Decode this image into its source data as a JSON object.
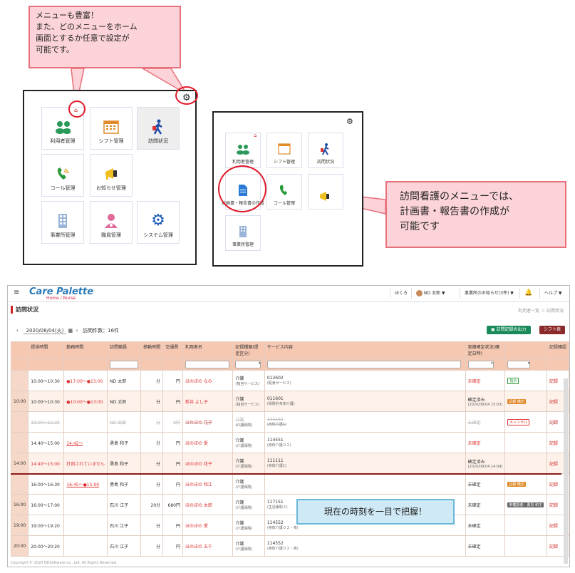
{
  "callouts": {
    "top_left": [
      "メニューも豊富！",
      "また、どのメニューをホーム",
      "画面とするか任意で設定が",
      "可能です。"
    ],
    "right": [
      "訪問看護のメニューでは、",
      "計画書・報告書の作成が",
      "可能です"
    ],
    "bottom": "現在の時刻を一目で把握！"
  },
  "panel1": {
    "tiles": [
      {
        "label": "利用者管理",
        "icon": "users-icon"
      },
      {
        "label": "シフト管理",
        "icon": "calendar-icon"
      },
      {
        "label": "訪問状況",
        "icon": "walking-person-icon"
      },
      {
        "label": "コール管理",
        "icon": "phone-icon"
      },
      {
        "label": "お知らせ管理",
        "icon": "megaphone-icon"
      },
      {
        "label": "事業所管理",
        "icon": "building-icon"
      },
      {
        "label": "職員管理",
        "icon": "staff-icon"
      },
      {
        "label": "システム管理",
        "icon": "gear-icon"
      }
    ]
  },
  "panel2": {
    "tiles": [
      {
        "label": "利用者管理",
        "icon": "users-icon"
      },
      {
        "label": "シフト管理",
        "icon": "calendar-icon"
      },
      {
        "label": "訪問状況",
        "icon": "walking-person-icon"
      },
      {
        "label": "計画書・報告書の作成",
        "icon": "document-icon"
      },
      {
        "label": "コール管理",
        "icon": "phone-icon"
      },
      {
        "label": "",
        "icon": "megaphone-icon"
      },
      {
        "label": "事業所管理",
        "icon": "building-icon"
      }
    ]
  },
  "app": {
    "logo": "Care Palette",
    "logo_sub": "Home / Nurse",
    "header": {
      "user1": "ほくろ",
      "user2": "ND 太郎",
      "notices": "事業所のお知らせ(3件)",
      "help": "ヘルプ"
    },
    "page_title": "訪問状況",
    "breadcrumb": "利用者一覧 ＞ 訪問状況",
    "date": "2020/08/04(火)",
    "visit_count": "訪問件数：16件",
    "btn_export": "訪問記録の出力",
    "btn_shift": "シフト表",
    "columns": [
      "",
      "提供時間",
      "勤務時間",
      "訪問職員",
      "移動時間",
      "交通費",
      "利用者名",
      "記録種類(提定区分)",
      "サービス内容",
      "",
      "実績確定状況(確定日時)",
      "",
      "記録確認"
    ],
    "rows": [
      {
        "hour": "",
        "time": "10:00～10:30",
        "work": "●17:00～●13:00",
        "staff": "ND 太郎",
        "move": "分",
        "fare": "円",
        "user": "ほのぼの なみ",
        "kind": "介護",
        "kind2": "(独自サービス)",
        "svc": "012602",
        "svc2": "(配食サービス)",
        "status": "未確定",
        "status2": "",
        "tag": "指示",
        "rec": "記録"
      },
      {
        "hour": "10:00",
        "time": "10:00～10:30",
        "work": "●10:00～●13:00",
        "staff": "ND 太郎",
        "move": "分",
        "fare": "円",
        "user": "新井 よし子",
        "kind": "介護",
        "kind2": "(独自サービス)",
        "svc": "011601",
        "svc2": "(保険外身体介護)",
        "status": "確定済み",
        "status2": "(2020/08/04 15:03)",
        "tag": "記録 備忘",
        "rec": "記録"
      },
      {
        "hour": "",
        "time": "10:00～10:30",
        "work": "",
        "staff": "ND 太郎",
        "move": "分",
        "fare": "0円",
        "user": "ほのぼの 花子",
        "kind": "介護",
        "kind2": "(介護保険)",
        "svc": "111111",
        "svc2": "(身体介護1)",
        "status": "未確定",
        "status2": "",
        "tag": "キャンセル",
        "rec": "記録"
      },
      {
        "hour": "",
        "time": "14:40～15:00",
        "work": "14:42～",
        "staff": "勇島 和子",
        "move": "分",
        "fare": "円",
        "user": "ほのぼの 愛",
        "kind": "介護",
        "kind2": "(介護保険)",
        "svc": "114551",
        "svc2": "(身体介護０２)",
        "status": "未確定",
        "status2": "",
        "tag": "",
        "rec": "記録"
      },
      {
        "hour": "14:00",
        "time": "14:40～15:00",
        "work": "打刻されていません",
        "staff": "勇島 和子",
        "move": "分",
        "fare": "円",
        "user": "ほのぼの 花子",
        "kind": "介護",
        "kind2": "(介護保険)",
        "svc": "111111",
        "svc2": "(身体介護1)",
        "status": "確定済み",
        "status2": "(2020/08/04 14:04)",
        "tag": "",
        "rec": "記録"
      },
      {
        "hour": "",
        "time": "16:00～16:30",
        "work": "16:45～●15:00",
        "staff": "勇島 和子",
        "move": "分",
        "fare": "円",
        "user": "ほのぼの 和江",
        "kind": "介護",
        "kind2": "(介護保険)",
        "svc": "",
        "svc2": "",
        "status": "未確定",
        "status2": "",
        "tag": "記録 備忘",
        "rec": "記録"
      },
      {
        "hour": "16:00",
        "time": "16:00～17:00",
        "work": "",
        "staff": "石川 江子",
        "move": "20分",
        "fare": "680円",
        "user": "ほのぼの 太郎",
        "kind": "介護",
        "kind2": "(介護保険)",
        "svc": "117151",
        "svc2": "(生活援助３)",
        "status": "未確定",
        "status2": "",
        "tag": "未確認者：勇島 和子",
        "rec": "記録"
      },
      {
        "hour": "19:00",
        "time": "19:00～19:20",
        "work": "",
        "staff": "石川 江子",
        "move": "分",
        "fare": "円",
        "user": "ほのぼの 愛",
        "kind": "介護",
        "kind2": "(介護保険)",
        "svc": "114552",
        "svc2": "(身体介護０２・夜)",
        "status": "未確定",
        "status2": "",
        "tag": "",
        "rec": "記録"
      },
      {
        "hour": "20:00",
        "time": "20:00～20:20",
        "work": "",
        "staff": "石川 江子",
        "move": "分",
        "fare": "円",
        "user": "ほのぼの 五千",
        "kind": "介護",
        "kind2": "(介護保険)",
        "svc": "114552",
        "svc2": "(身体介護０２・夜)",
        "status": "未確定",
        "status2": "",
        "tag": "",
        "rec": "記録"
      }
    ],
    "footer": "Copyright © 2020 NDSoftware co., Ltd. All Rights Reserved."
  },
  "colors": {
    "accent_red": "#e01a2a",
    "callout_pink": "#fbd3d8",
    "table_header": "#f6c8b2",
    "export_green": "#1a8a5a",
    "shift_red": "#8b2a2a"
  }
}
